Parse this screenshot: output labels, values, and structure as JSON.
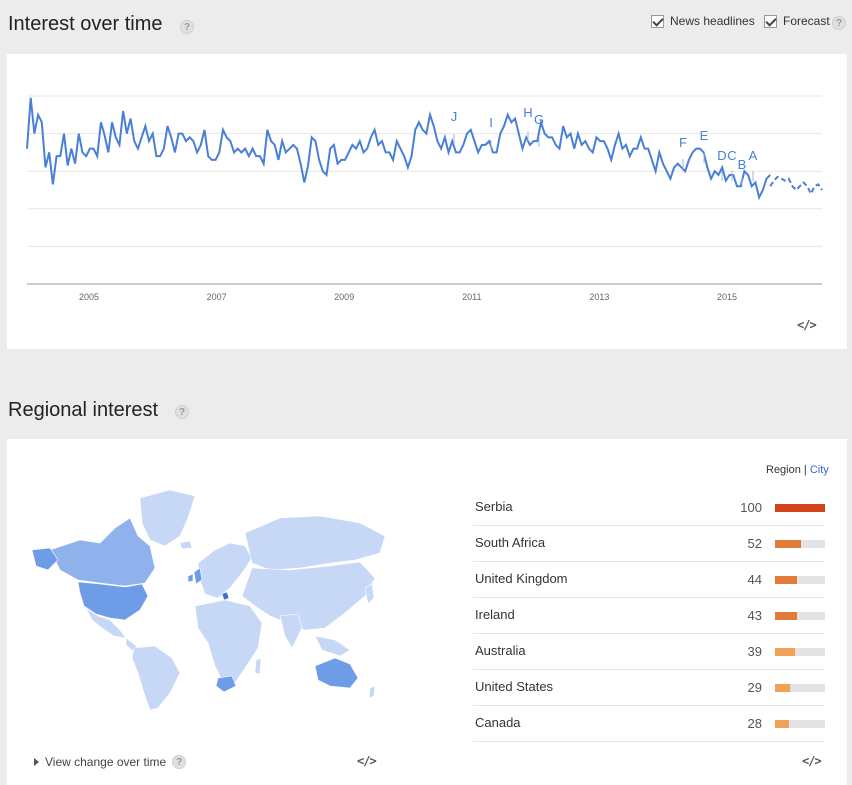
{
  "interest": {
    "title": "Interest over time",
    "help": "?",
    "news_headlines_label": "News headlines",
    "forecast_label": "Forecast",
    "embed": "</>",
    "chart_data": {
      "type": "line",
      "x_ticks": [
        "2005",
        "2007",
        "2009",
        "2011",
        "2013",
        "2015"
      ],
      "ylim": [
        0,
        100
      ],
      "grid": true,
      "series": [
        {
          "values": [
            72,
            99,
            80,
            90,
            86,
            62,
            70,
            53,
            68,
            68,
            80,
            63,
            72,
            64,
            80,
            70,
            68,
            72,
            72,
            68,
            86,
            79,
            70,
            86,
            78,
            74,
            92,
            80,
            88,
            76,
            72,
            78,
            84,
            76,
            80,
            68,
            68,
            72,
            84,
            78,
            70,
            80,
            80,
            76,
            78,
            76,
            70,
            74,
            82,
            68,
            66,
            66,
            70,
            82,
            78,
            76,
            70,
            72,
            70,
            72,
            68,
            72,
            68,
            68,
            64,
            82,
            76,
            74,
            66,
            76,
            70,
            72,
            74,
            72,
            64,
            54,
            63,
            78,
            76,
            66,
            60,
            58,
            72,
            74,
            64,
            66,
            66,
            70,
            74,
            72,
            76,
            70,
            72,
            78,
            82,
            74,
            76,
            70,
            70,
            66,
            76,
            72,
            68,
            62,
            68,
            82,
            86,
            82,
            80,
            90,
            84,
            76,
            72,
            78,
            70,
            76,
            70,
            70,
            74,
            80,
            82,
            76,
            70,
            74,
            74,
            76,
            70,
            70,
            80,
            84,
            90,
            86,
            88,
            80,
            72,
            78,
            74,
            76,
            76,
            86,
            80,
            78,
            78,
            74,
            72,
            84,
            78,
            80,
            72,
            80,
            74,
            76,
            72,
            70,
            78,
            76,
            76,
            72,
            66,
            74,
            80,
            72,
            74,
            68,
            72,
            72,
            78,
            72,
            72,
            66,
            60,
            70,
            64,
            60,
            56,
            62,
            64,
            62,
            60,
            66,
            70,
            72,
            72,
            70,
            62,
            56,
            60,
            58,
            62,
            55,
            58,
            58,
            52,
            52,
            60,
            58,
            52,
            54,
            46,
            50,
            56,
            58
          ]
        },
        {
          "name": "Forecast",
          "values": [
            52,
            55,
            57,
            56,
            55,
            56,
            52,
            50,
            52,
            54,
            52,
            48,
            52,
            53,
            50
          ]
        }
      ],
      "annotations": [
        {
          "label": "J"
        },
        {
          "label": "I"
        },
        {
          "label": "H"
        },
        {
          "label": "G"
        },
        {
          "label": "F"
        },
        {
          "label": "E"
        },
        {
          "label": "D"
        },
        {
          "label": "C"
        },
        {
          "label": "B"
        },
        {
          "label": "A"
        }
      ]
    }
  },
  "regional": {
    "title": "Regional interest",
    "help": "?",
    "toggle_region": "Region",
    "toggle_city": "City",
    "embed_map": "</>",
    "embed_table": "</>",
    "view_change": "View change over time",
    "rows": [
      {
        "name": "Serbia",
        "value": "100",
        "level": 100,
        "color": "#d14319"
      },
      {
        "name": "South Africa",
        "value": "52",
        "level": 52,
        "color": "#e07b3a"
      },
      {
        "name": "United Kingdom",
        "value": "44",
        "level": 44,
        "color": "#e07b3a"
      },
      {
        "name": "Ireland",
        "value": "43",
        "level": 43,
        "color": "#e07b3a"
      },
      {
        "name": "Australia",
        "value": "39",
        "level": 39,
        "color": "#f0a256"
      },
      {
        "name": "United States",
        "value": "29",
        "level": 29,
        "color": "#f0a256"
      },
      {
        "name": "Canada",
        "value": "28",
        "level": 28,
        "color": "#f0a256"
      }
    ]
  },
  "colors": {
    "line": "#4a7fd6",
    "map_base": "#c6d8f5",
    "map_mid": "#8fb1ec",
    "map_high": "#6f9ce6",
    "map_serbia": "#3a6fd6",
    "bar_track": "#e3e3e3"
  }
}
